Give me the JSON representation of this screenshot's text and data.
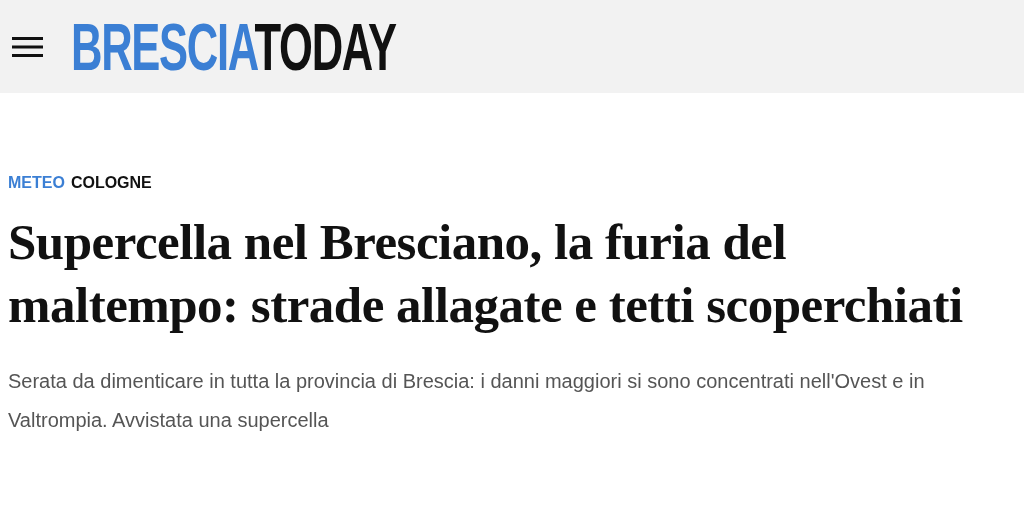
{
  "header": {
    "logo": {
      "primary": "BRESCIA",
      "secondary": "TODAY"
    }
  },
  "article": {
    "section": "METEO",
    "location": "COLOGNE",
    "headline": "Supercella nel Bresciano, la furia del maltempo: strade allagate e tetti scoperchiati",
    "summary": "Serata da dimenticare in tutta la provincia di Brescia: i danni maggiori si sono concentrati nell'Ovest e in Valtrompia. Avvistata una supercella"
  }
}
